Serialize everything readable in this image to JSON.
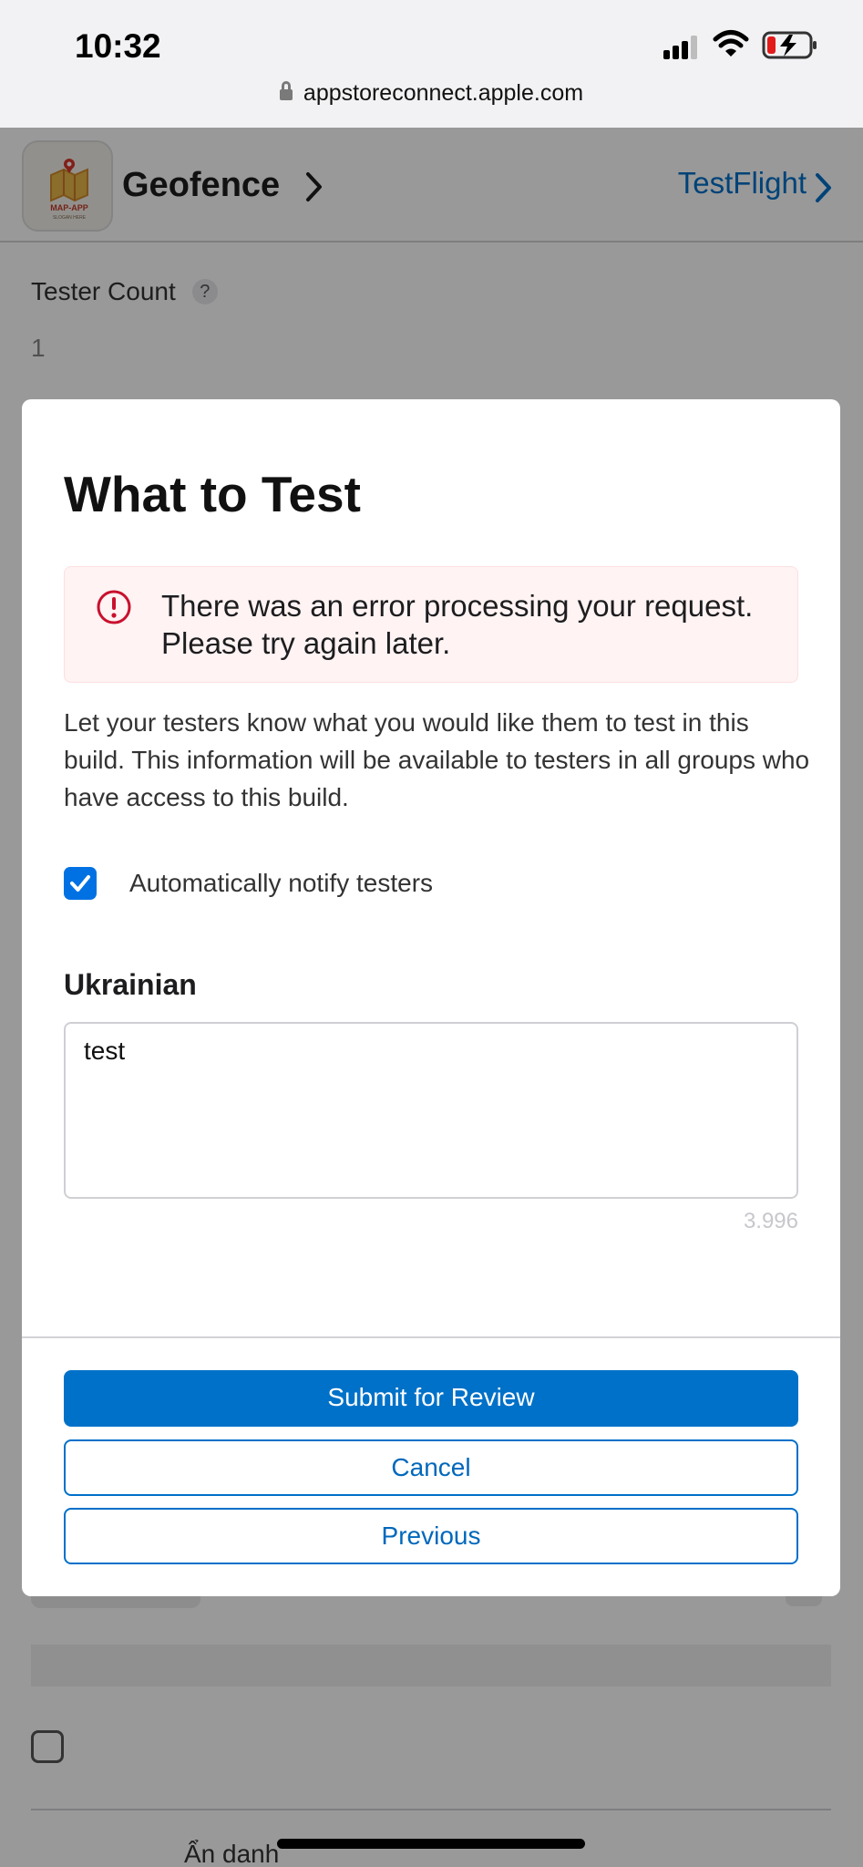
{
  "status_bar": {
    "time": "10:32"
  },
  "browser": {
    "url": "appstoreconnect.apple.com"
  },
  "app_header": {
    "app_name": "Geofence",
    "testflight_link": "TestFlight"
  },
  "background": {
    "tester_count_label": "Tester Count",
    "help_glyph": "?",
    "tester_count_value": "1",
    "anonymous_label": "Ẩn danh"
  },
  "modal": {
    "title": "What to Test",
    "error_message": "There was an error processing your request. Please try again later.",
    "description": "Let your testers know what you would like them to test in this build. This information will be available to testers in all groups who have access to this build.",
    "notify_label": "Automatically notify testers",
    "notify_checked": true,
    "language_label": "Ukrainian",
    "test_notes_value": "test",
    "char_counter": "3.996",
    "buttons": {
      "submit": "Submit for Review",
      "cancel": "Cancel",
      "previous": "Previous"
    }
  },
  "colors": {
    "accent": "#0071c8",
    "error_red": "#c8102e",
    "error_bg": "#fff3f3"
  },
  "icons": [
    "lock-icon",
    "signal-icon",
    "wifi-icon",
    "battery-charging-icon",
    "chevron-right-icon",
    "help-icon",
    "error-icon",
    "checkmark-icon"
  ]
}
